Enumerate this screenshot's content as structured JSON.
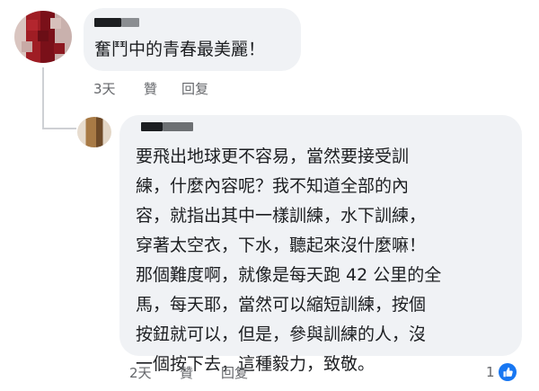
{
  "comments": [
    {
      "text": "奮鬥中的青春最美麗！",
      "time": "3天",
      "like_label": "贊",
      "reply_label": "回复"
    },
    {
      "lines": [
        "要飛出地球更不容易，當然要接受訓",
        "練，什麼內容呢？我不知道全部的內",
        "容，就指出其中一樣訓練，水下訓練，",
        "穿著太空衣，下水，聽起來沒什麼嘛！",
        "那個難度啊，就像是每天跑 42 公里的全",
        "馬，每天耶，當然可以縮短訓練，按個",
        "按鈕就可以，但是，參與訓練的人，沒",
        "一個按下去，這種毅力，致敬。"
      ],
      "time": "2天",
      "like_label": "贊",
      "reply_label": "回复",
      "reaction_count": "1",
      "reaction_icon": "thumbs-up-icon"
    }
  ],
  "colors": {
    "bubble": "#f0f2f5",
    "meta_text": "#65676b",
    "like_blue": "#1877f2",
    "thread_line": "#ced0d4"
  }
}
